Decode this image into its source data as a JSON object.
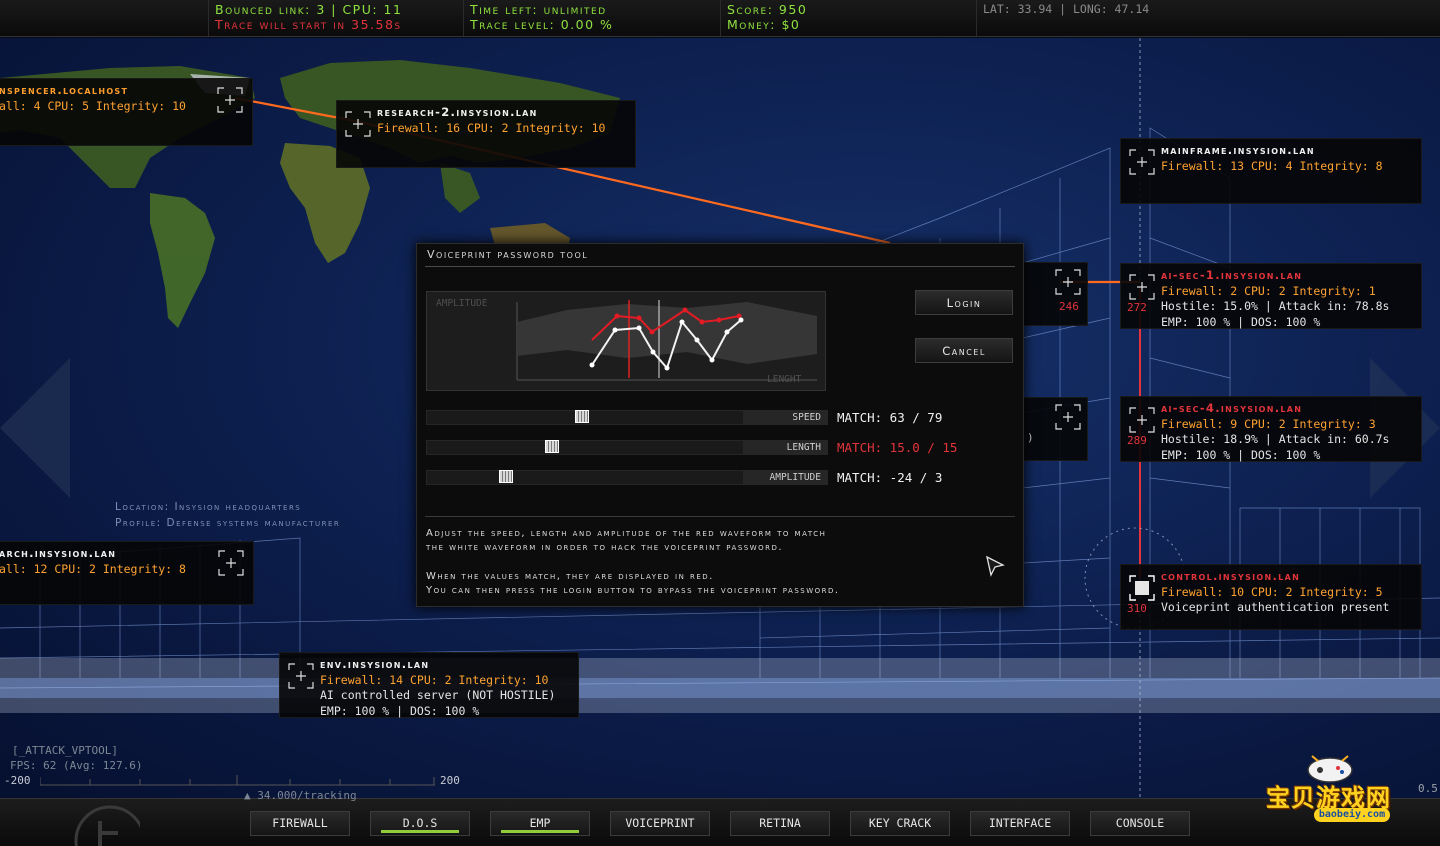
{
  "hud": {
    "bounced_link": "Bounced link: 3 | CPU: 11",
    "trace_warning": "Trace will start in 35.58s",
    "time_left": "Time left: unlimited",
    "trace_level": "Trace level: 0.00 %",
    "score": "Score: 950",
    "money": "Money: $0",
    "coords": "LAT: 33.94 | LONG: 47.14"
  },
  "nodes": [
    {
      "key": "localhost",
      "name": "nspencer.localhost",
      "stats": "all: 4 CPU: 5 Integrity: 10",
      "name_color": "orange"
    },
    {
      "key": "research2",
      "name": "research-2.insysion.lan",
      "stats": "Firewall: 16 CPU: 2 Integrity: 10"
    },
    {
      "key": "mainframe",
      "name": "mainframe.insysion.lan",
      "stats": "Firewall: 13 CPU: 4 Integrity: 8"
    },
    {
      "key": "aisec1",
      "name": "ai-sec-1.insysion.lan",
      "stats": "Firewall: 2 CPU: 2 Integrity: 1",
      "extra1": "Hostile: 15.0% | Attack in: 78.8s",
      "extra2": "EMP: 100 % | DOS: 100 %",
      "trace": "272",
      "name_color": "red"
    },
    {
      "key": "aisec4",
      "name": "ai-sec-4.insysion.lan",
      "stats": "Firewall: 9 CPU: 2 Integrity: 3",
      "extra1": "Hostile: 18.9% | Attack in: 60.7s",
      "extra2": "EMP: 100 % | DOS: 100 %",
      "trace": "289",
      "name_color": "red"
    },
    {
      "key": "control",
      "name": "control.insysion.lan",
      "stats": "Firewall: 10 CPU: 2 Integrity: 5",
      "extra1": "Voiceprint authentication present",
      "trace": "310",
      "name_color": "red"
    },
    {
      "key": "search",
      "name": "arch.insysion.lan",
      "stats": "all: 12 CPU: 2 Integrity: 8"
    },
    {
      "key": "env",
      "name": "env.insysion.lan",
      "stats": "Firewall: 14 CPU: 2 Integrity: 10",
      "extra1": "AI controlled server (NOT HOSTILE)",
      "extra2": "EMP: 100 % | DOS: 100 %"
    }
  ],
  "hidden_node": {
    "trace": "246",
    "partial": ")"
  },
  "location": {
    "location": "Location: Insysion headquarters",
    "profile": "Profile: Defense systems manufacturer"
  },
  "voiceprint": {
    "title": "Voiceprint password tool",
    "amplitude_axis": "AMPLITUDE",
    "length_axis": "LENGHT",
    "login_label": "Login",
    "cancel_label": "Cancel",
    "sliders": [
      {
        "label": "SPEED",
        "match": "MATCH: 63 / 79",
        "matched": false,
        "position": 0.49
      },
      {
        "label": "LENGTH",
        "match": "MATCH: 15.0 / 15",
        "matched": true,
        "position": 0.39
      },
      {
        "label": "AMPLITUDE",
        "match": "MATCH: -24 / 3",
        "matched": false,
        "position": 0.24
      }
    ],
    "instructions": [
      "Adjust the speed, length and amplitude of the red waveform to match",
      "the white waveform in order to hack the voiceprint password.",
      "When the values match, they are displayed in red.",
      "You can then press the login button to bypass the voiceprint password."
    ]
  },
  "debug": {
    "attack_tag": "[_ATTACK_VPTOOL]",
    "fps": "FPS:  62 (Avg: 127.6)",
    "scale_min": "-200",
    "scale_max": "200",
    "tracking": "34.000/tracking",
    "right_value": "0.5"
  },
  "toolbar": [
    "FIREWALL",
    "D.O.S",
    "EMP",
    "VOICEPRINT",
    "RETINA",
    "KEY CRACK",
    "INTERFACE",
    "CONSOLE"
  ],
  "toolbar_active": [
    "D.O.S",
    "EMP"
  ],
  "watermark": {
    "title": "宝贝游戏网",
    "url": "baobeiy.com"
  },
  "colors": {
    "accent_green": "#8fe13f",
    "trace_red": "#e3343b",
    "stats_orange": "#ffa231",
    "link_orange": "#ff6a1f"
  }
}
